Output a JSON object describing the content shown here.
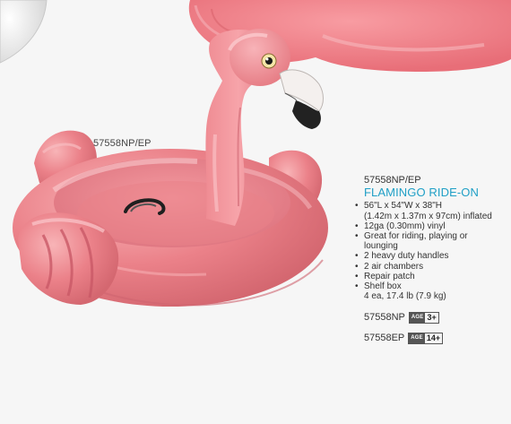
{
  "image_caption": "57558NP/EP",
  "product": {
    "sku_header": "57558NP/EP",
    "title": "FLAMINGO RIDE-ON",
    "features": [
      "56\"L x 54\"W x 38\"H",
      "(1.42m x 1.37m x 97cm) inflated",
      "12ga (0.30mm) vinyl",
      "Great for riding, playing or",
      "lounging",
      "2 heavy duty handles",
      "2 air chambers",
      "Repair patch",
      "Shelf box"
    ],
    "pack": "4 ea, 17.4 lb (7.9 kg)",
    "variants": [
      {
        "code": "57558NP",
        "age_label": "AGE",
        "age": "3+"
      },
      {
        "code": "57558EP",
        "age_label": "AGE",
        "age": "14+"
      }
    ]
  },
  "colors": {
    "flamingo_pink": "#ef8f95",
    "body_deep": "#df6f78",
    "title_blue": "#1f9fc6",
    "beak": "#222222"
  }
}
